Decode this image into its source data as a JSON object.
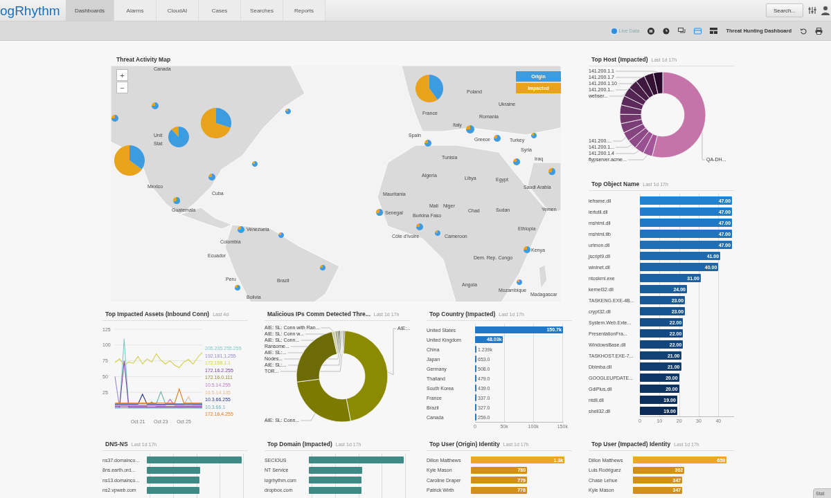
{
  "header": {
    "logo": "ogRhythm",
    "tabs": [
      {
        "label": "Dashboards",
        "selected": true
      },
      {
        "label": "Alarms",
        "selected": false
      },
      {
        "label": "CloudAI",
        "selected": false
      },
      {
        "label": "Cases",
        "selected": false
      },
      {
        "label": "Searches",
        "selected": false
      },
      {
        "label": "Reports",
        "selected": false
      }
    ],
    "search_button": "Search..."
  },
  "toolbar": {
    "live": {
      "label": "Live Data",
      "on": true
    },
    "dashboard_name": "Threat Hunting Dashboard"
  },
  "map_panel": {
    "title": "Threat Activity Map",
    "zoom_in": "+",
    "zoom_out": "−",
    "legend": [
      {
        "label": "Origin",
        "color": "#3d9be0"
      },
      {
        "label": "Impacted",
        "color": "#e8a21c"
      }
    ],
    "labels": [
      "Canada",
      "Unit",
      "Stat",
      "Mexico",
      "Cuba",
      "Guatemala",
      "Venezuela",
      "Colombia",
      "Ecuador",
      "Peru",
      "Brazil",
      "Bolivia",
      "Poland",
      "Ukraine",
      "France",
      "Romania",
      "Italy",
      "Spain",
      "Greece",
      "Turkey",
      "Syria",
      "Tunisia",
      "Iraq",
      "Algeria",
      "Libya",
      "Egypt",
      "Saudi Arabia",
      "Mauritania",
      "Mali",
      "Niger",
      "Chad",
      "Sudan",
      "Yemen",
      "Senegal",
      "Burkina Faso",
      "Ethiopia",
      "Côte d'Ivoire",
      "Cameroon",
      "Kenya",
      "Dem. Rep. Congo",
      "Angola",
      "Mozambique",
      "Madagascar"
    ]
  },
  "top_host": {
    "title": "Top Host (Impacted)",
    "subtitle": "Last 1d 17h",
    "labels": [
      "141.200.1.1",
      "141.200.1.7",
      "141.200.1.10",
      "141.200.1...",
      "webser...",
      "141.200....",
      "141.200.1...",
      "141.200.1.4",
      "flypserver.acme...",
      "QA-DH..."
    ]
  },
  "top_object": {
    "title": "Top Object Name",
    "subtitle": "Last 1d 17h",
    "chart_data": {
      "type": "bar",
      "orientation": "horizontal",
      "categories": [
        "ieframe.dll",
        "iertutil.dll",
        "mshtml.dll",
        "mshtml.tlb",
        "urlmon.dll",
        "jscript9.dll",
        "wininet.dll",
        "ntoskrnl.exe",
        "kernel32.dll",
        "TASKENG.EXE-4B...",
        "crypt32.dll",
        "System.Web.Exte...",
        "PresentationFra...",
        "WindowsBase.dll",
        "TASKHOST.EXE-7...",
        "Dbimba.dll",
        "GOOGLEUPDATE...",
        "GdiPlus.dll",
        "ntdll.dll",
        "shell32.dll"
      ],
      "values": [
        47,
        47,
        47,
        47,
        47,
        41,
        40,
        31,
        24,
        23,
        23,
        22,
        22,
        22,
        21,
        21,
        20,
        20,
        19,
        19
      ],
      "value_labels": [
        "47.00",
        "47.00",
        "47.00",
        "47.00",
        "47.00",
        "41.00",
        "40.00",
        "31.00",
        "24.00",
        "23.00",
        "23.00",
        "22.00",
        "22.00",
        "22.00",
        "21.00",
        "21.00",
        "20.00",
        "20.00",
        "19.00",
        "19.00"
      ],
      "xlim": [
        0,
        48
      ],
      "xticks": [
        0,
        10,
        20,
        30,
        40
      ]
    }
  },
  "impacted_assets": {
    "title": "Top Impacted Assets (Inbound Conn)",
    "subtitle": "Last 4d",
    "chart_data": {
      "type": "line",
      "categories": [
        null,
        null,
        null,
        null,
        null,
        "Oct 21",
        null,
        null,
        null,
        null,
        "Oct 23",
        null,
        null,
        null,
        null,
        "Oct 25",
        null,
        null,
        null,
        null
      ],
      "ylim": [
        0,
        125
      ],
      "yticks": [
        25,
        50,
        75,
        100,
        125
      ],
      "grid": true,
      "series": [
        {
          "name": "205.235.255.255",
          "color": "#7ec9c6",
          "values": [
            0,
            0,
            110,
            0,
            0,
            0,
            0,
            0,
            0,
            0,
            0,
            0,
            0,
            0,
            0,
            0,
            0,
            0,
            0,
            0
          ]
        },
        {
          "name": "192.181.1.255",
          "color": "#9a8ad0",
          "values": [
            50,
            1,
            1,
            1,
            1,
            1,
            1,
            1,
            1,
            1,
            1,
            1,
            1,
            1,
            1,
            1,
            1,
            1,
            1,
            1
          ]
        },
        {
          "name": "172.168.1.1",
          "color": "#d4cf4a",
          "values": [
            72,
            78,
            68,
            73,
            71,
            82,
            70,
            78,
            73,
            86,
            76,
            70,
            75,
            68,
            64,
            73,
            77,
            70,
            80,
            88
          ]
        },
        {
          "name": "172.16.2.255",
          "color": "#7a3fa0",
          "values": [
            2,
            2,
            75,
            2,
            2,
            2,
            2,
            2,
            2,
            2,
            2,
            2,
            2,
            2,
            2,
            2,
            2,
            2,
            2,
            2
          ]
        },
        {
          "name": "172.16.0.111",
          "color": "#8c8a2a",
          "values": [
            3,
            3,
            3,
            3,
            3,
            3,
            3,
            3,
            10,
            3,
            3,
            3,
            3,
            3,
            3,
            3,
            3,
            3,
            3,
            3
          ]
        },
        {
          "name": "10.5.14.255",
          "color": "#c07ac0",
          "values": [
            4,
            4,
            4,
            4,
            4,
            4,
            4,
            4,
            4,
            4,
            4,
            4,
            14,
            4,
            4,
            4,
            4,
            4,
            4,
            4
          ]
        },
        {
          "name": "16.5.14.135",
          "color": "#e8b890",
          "values": [
            5,
            5,
            5,
            5,
            5,
            5,
            5,
            5,
            5,
            5,
            5,
            5,
            5,
            5,
            5,
            5,
            18,
            5,
            5,
            5
          ]
        },
        {
          "name": "10.3.66.255",
          "color": "#2a3a8a",
          "values": [
            6,
            6,
            6,
            6,
            6,
            6,
            22,
            6,
            6,
            6,
            6,
            6,
            6,
            6,
            6,
            6,
            6,
            6,
            6,
            6
          ]
        },
        {
          "name": "10.3.66.1",
          "color": "#6ab0b0",
          "values": [
            7,
            7,
            7,
            7,
            7,
            7,
            7,
            7,
            7,
            7,
            26,
            7,
            7,
            7,
            7,
            7,
            7,
            7,
            7,
            7
          ]
        },
        {
          "name": "172.16.4.255",
          "color": "#e07a20",
          "values": [
            8,
            8,
            8,
            8,
            8,
            8,
            8,
            8,
            8,
            8,
            8,
            8,
            8,
            8,
            30,
            8,
            8,
            8,
            8,
            8
          ]
        }
      ]
    }
  },
  "malicious_ips": {
    "title": "Malicious IPs Comm Detected Thre...",
    "subtitle": "Last 1d 17h",
    "labels": [
      "AIE: SL: Conn with Ran...",
      "AIE: SL: Conn w...",
      "AIE: SL: Conn...",
      "Ransome...",
      "AIE: SL:...",
      "Nodes...",
      "AIE: SL:...",
      "TOR...",
      "AIE: SL: Conn...",
      "AIE:..."
    ]
  },
  "top_country": {
    "title": "Top Country (Impacted)",
    "subtitle": "Last 1d 17h",
    "chart_data": {
      "type": "bar",
      "orientation": "horizontal",
      "categories": [
        "United States",
        "United Kingdom",
        "China",
        "Japan",
        "Germany",
        "Thailand",
        "South Korea",
        "France",
        "Brazil",
        "Canada"
      ],
      "values": [
        150700,
        48030,
        1239,
        653,
        508,
        479,
        439,
        337,
        327,
        259
      ],
      "value_labels": [
        "150.7k",
        "48.03k",
        "1.239k",
        "653.0",
        "508.0",
        "479.0",
        "439.0",
        "337.0",
        "327.0",
        "259.0"
      ],
      "xlim": [
        0,
        152000
      ],
      "xticks": [
        {
          "value": 0,
          "label": "0"
        },
        {
          "value": 50000,
          "label": "50k"
        },
        {
          "value": 100000,
          "label": "100k"
        },
        {
          "value": 150000,
          "label": "150k"
        }
      ]
    }
  },
  "dns_ns": {
    "title": "DNS-NS",
    "subtitle": "Last 1d 17h",
    "labels": [
      "ns37.domainco...",
      "8ns.earth.ord...",
      "ns13.domainco...",
      "ns2.vpweb.com"
    ]
  },
  "top_domain": {
    "title": "Top Domain (Impacted)",
    "subtitle": "Last 1d 17h",
    "labels": [
      "SECIOUS",
      "NT Service",
      "logrhythm.com",
      "dropbox.com"
    ]
  },
  "top_user_origin": {
    "title": "Top User (Origin) Identity",
    "subtitle": "Last 1d 17h",
    "chart_data": {
      "type": "bar",
      "orientation": "horizontal",
      "categories": [
        "Dillon Matthews",
        "Kyle Mason",
        "Caroline Draper",
        "Patrick Wirth"
      ],
      "values": [
        1300,
        780,
        779,
        778
      ],
      "value_labels": [
        "1.3k",
        "780",
        "779",
        "778"
      ]
    }
  },
  "top_user_impacted": {
    "title": "Top User (Impacted) Identity",
    "subtitle": "Last 1d 17h",
    "chart_data": {
      "type": "bar",
      "orientation": "horizontal",
      "categories": [
        "Dillon Matthews",
        "Luis Rodriguez",
        "Chase Lehue",
        "Kyle Mason"
      ],
      "values": [
        659,
        362,
        347,
        347
      ],
      "value_labels": [
        "659",
        "362",
        "347",
        "347"
      ]
    }
  },
  "status_tab": "Stat"
}
